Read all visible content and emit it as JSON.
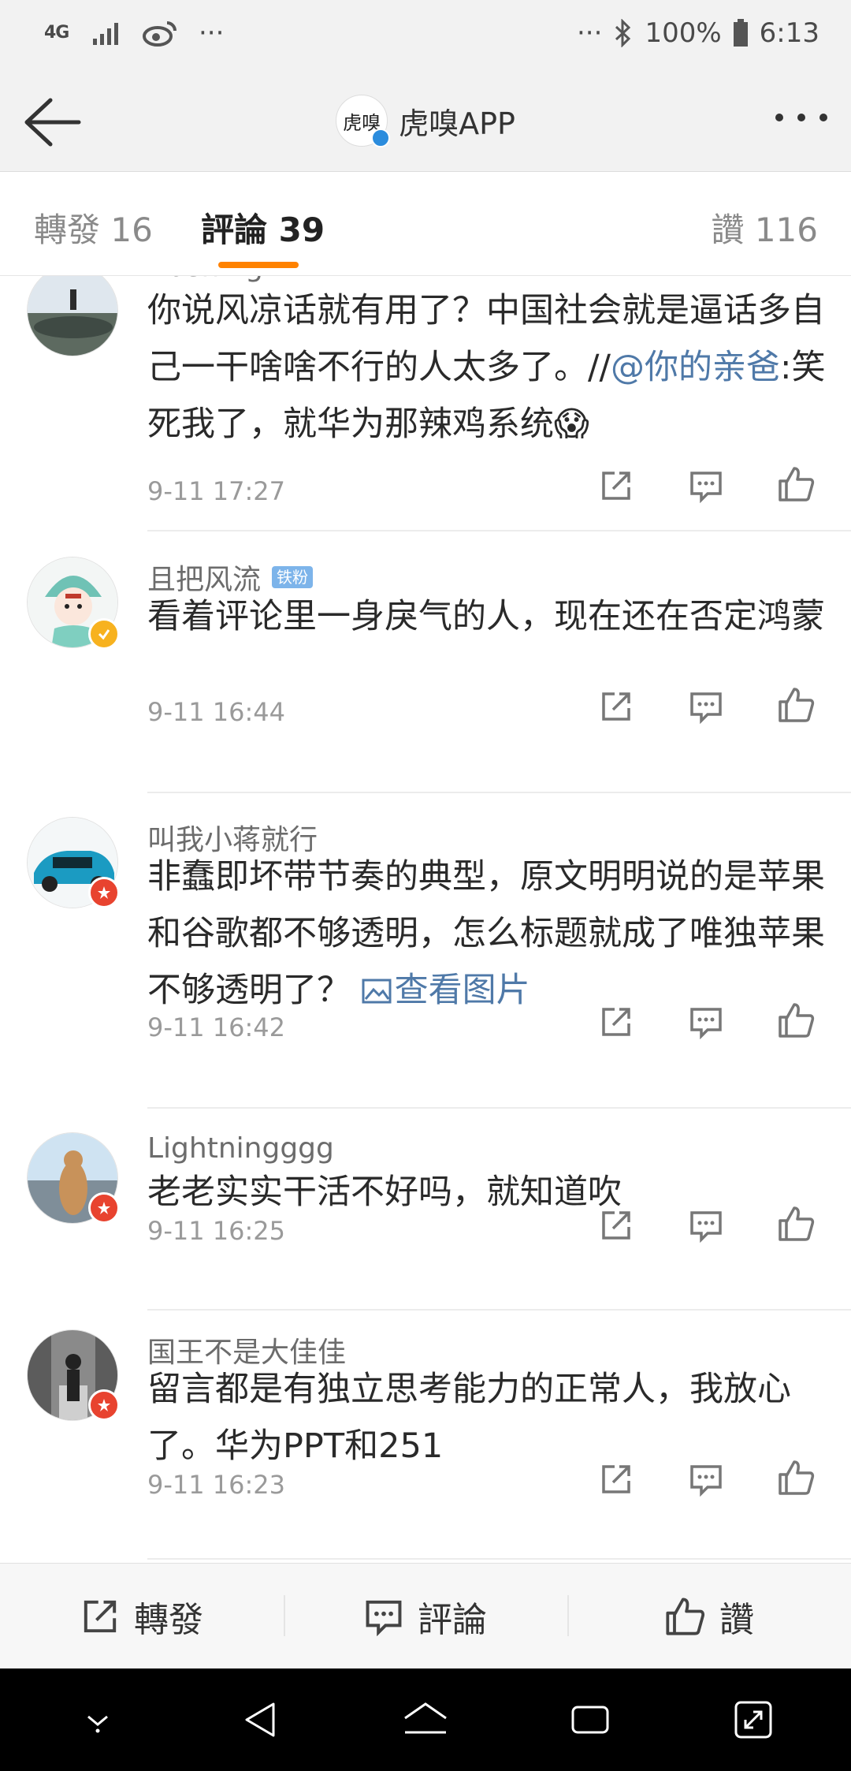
{
  "status_bar": {
    "network": "4G",
    "battery": "100%",
    "time": "6:13",
    "more_left": "···",
    "more_right": "···"
  },
  "header": {
    "logo_text": "虎嗅",
    "title": "虎嗅APP"
  },
  "tabs": {
    "repost": "轉發 16",
    "comments": "評論 39",
    "likes": "讚 116"
  },
  "comments": [
    {
      "user": "Dashing-K",
      "segments": [
        {
          "t": "你说风凉话就有用了？中国社会就是逼话多自己一干啥啥不行的人太多了。//"
        },
        {
          "t": "@你的亲爸",
          "link": true
        },
        {
          "t": ":笑死我了，就华为那辣鸡系统"
        }
      ],
      "emoji": "😱",
      "time": "9-11 17:27"
    },
    {
      "user": "且把风流",
      "fan_badge": "铁粉",
      "segments": [
        {
          "t": "看着评论里一身戾气的人，现在还在否定鸿蒙"
        }
      ],
      "time": "9-11 16:44"
    },
    {
      "user": "叫我小蒋就行",
      "segments": [
        {
          "t": "非蠢即坏带节奏的典型，原文明明说的是苹果和谷歌都不够透明，怎么标题就成了唯独苹果不够透明了？ "
        }
      ],
      "image_link": "查看图片",
      "time": "9-11 16:42"
    },
    {
      "user": "Lightningggg",
      "segments": [
        {
          "t": "老老实实干活不好吗，就知道吹"
        }
      ],
      "time": "9-11 16:25"
    },
    {
      "user": "国王不是大佳佳",
      "segments": [
        {
          "t": "留言都是有独立思考能力的正常人，我放心了。华为PPT和251"
        }
      ],
      "time": "9-11 16:23"
    }
  ],
  "bottom_bar": {
    "repost": "轉發",
    "comment": "評論",
    "like": "讚"
  },
  "colors": {
    "accent": "#ff8200",
    "link": "#4f79a8",
    "badge_red": "#e8432f",
    "badge_gold": "#f7b21f",
    "fan_badge": "#7db4ea"
  }
}
